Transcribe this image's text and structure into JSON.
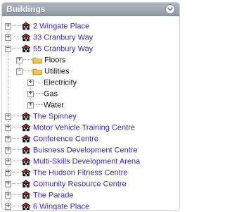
{
  "panel": {
    "title": "Buildings",
    "toggle_icon": "chevron-down-icon"
  },
  "tree": {
    "items": [
      {
        "label": "2 Wingate Place",
        "type": "building",
        "expanded": false,
        "level": 0
      },
      {
        "label": "33 Cranbury Way",
        "type": "building",
        "expanded": false,
        "level": 0
      },
      {
        "label": "55 Cranbury Way",
        "type": "building",
        "expanded": true,
        "level": 0
      },
      {
        "label": "Floors",
        "type": "folder",
        "expanded": false,
        "level": 1
      },
      {
        "label": "Utilities",
        "type": "folder",
        "expanded": true,
        "level": 1
      },
      {
        "label": "Electricity",
        "type": "leaf",
        "expanded": false,
        "level": 2
      },
      {
        "label": "Gas",
        "type": "leaf",
        "expanded": false,
        "level": 2
      },
      {
        "label": "Water",
        "type": "leaf",
        "expanded": false,
        "level": 2
      },
      {
        "label": "The Spinney",
        "type": "building",
        "expanded": false,
        "level": 0
      },
      {
        "label": "Motor Vehicle Training Centre",
        "type": "building",
        "expanded": false,
        "level": 0
      },
      {
        "label": "Conference Centre",
        "type": "building",
        "expanded": false,
        "level": 0
      },
      {
        "label": "Buisness Development Centre",
        "type": "building",
        "expanded": false,
        "level": 0
      },
      {
        "label": "Multi-Skills Development Arena",
        "type": "building",
        "expanded": false,
        "level": 0
      },
      {
        "label": "The Hudson Fitness Centre",
        "type": "building",
        "expanded": false,
        "level": 0
      },
      {
        "label": "Comunity Resource Centre",
        "type": "building",
        "expanded": false,
        "level": 0
      },
      {
        "label": "The Parade",
        "type": "building",
        "expanded": false,
        "level": 0
      },
      {
        "label": "6 Wingate Place",
        "type": "building",
        "expanded": false,
        "level": 0
      }
    ]
  },
  "colors": {
    "header_top": "#aeb7c1",
    "header_bottom": "#8f99a4",
    "link": "#3b25c9",
    "text": "#111111",
    "folder": "#f3c54a",
    "building_icon_red": "#c52020",
    "building_icon_dark": "#1a1a1a"
  }
}
